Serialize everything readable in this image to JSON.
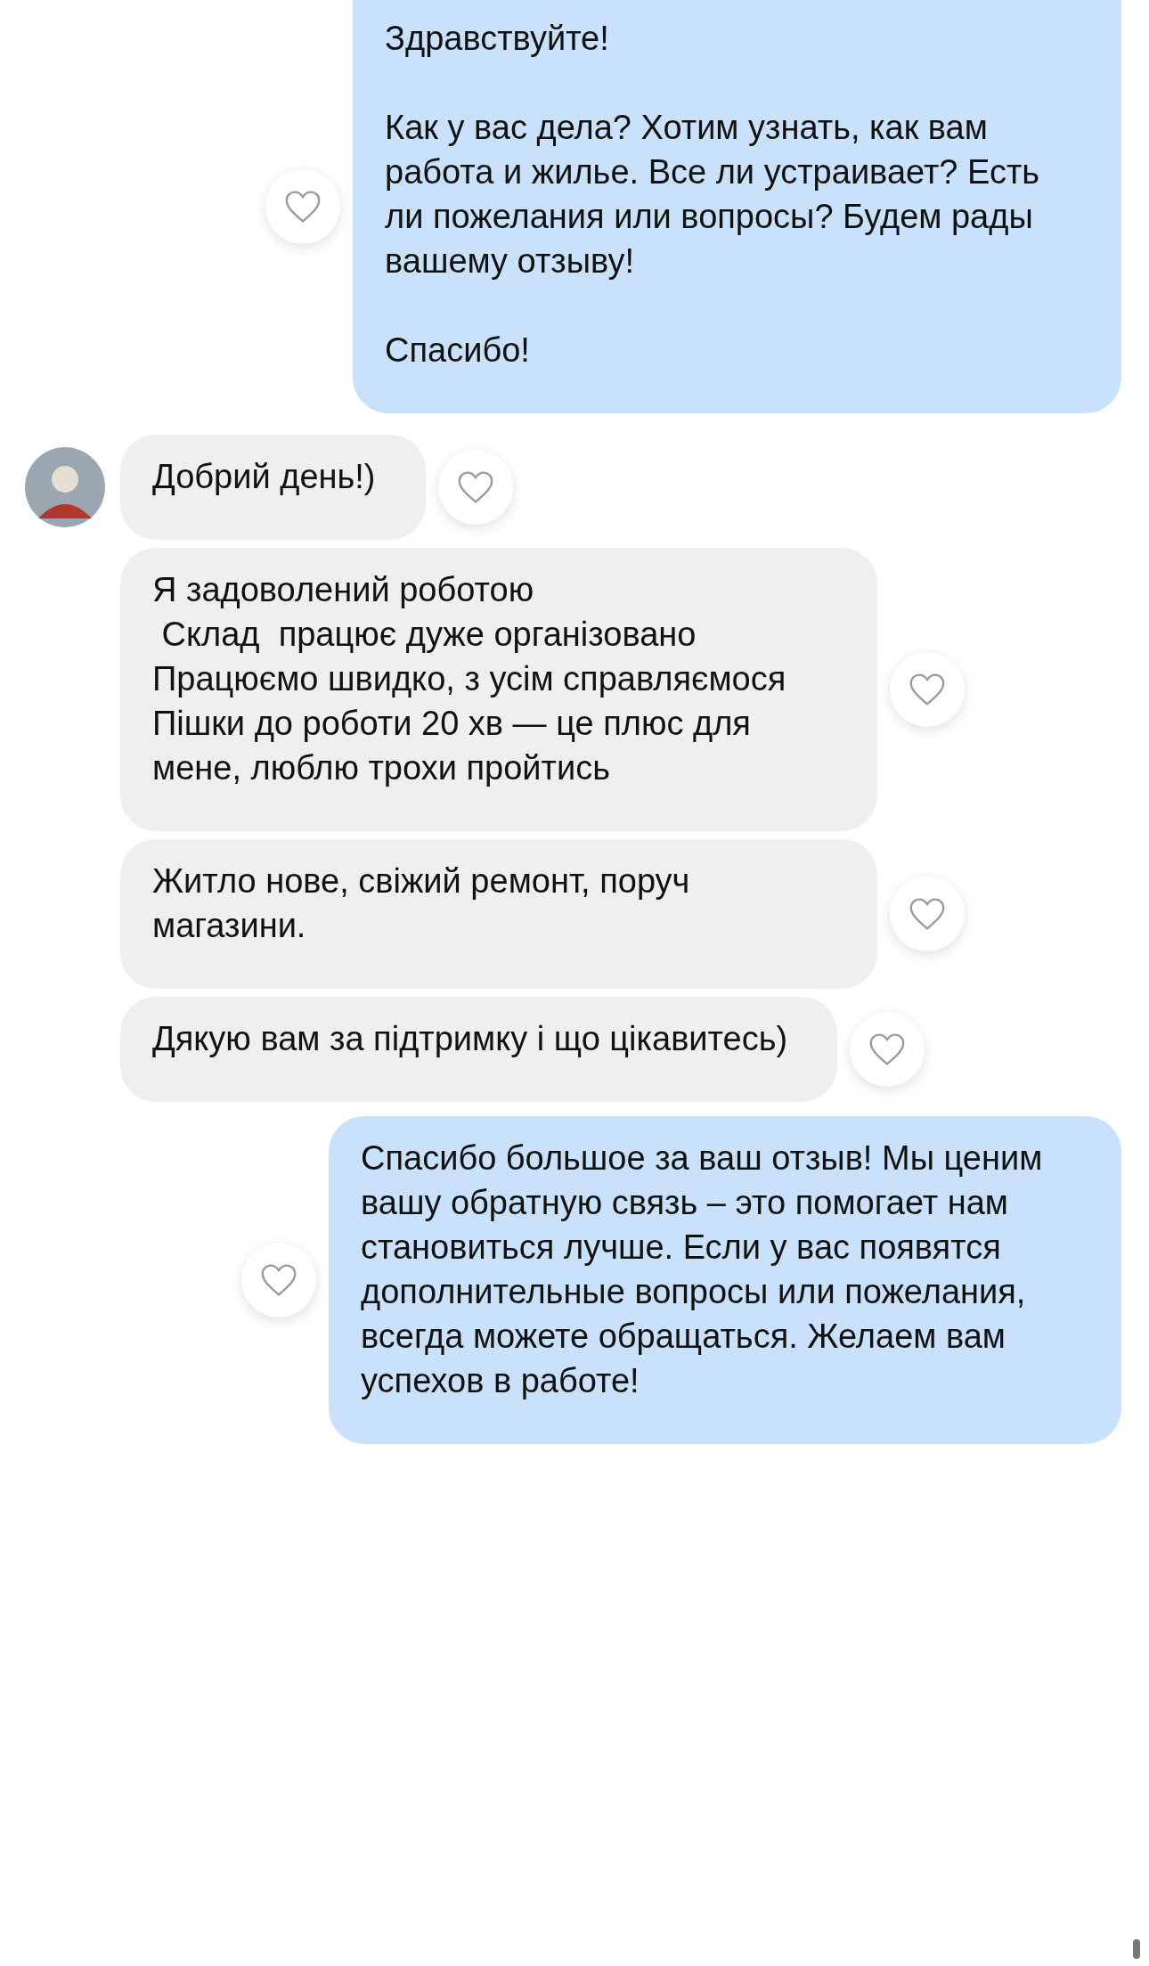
{
  "messages": [
    {
      "kind": "outgoing",
      "liked": false,
      "text": "Здравствуйте!\n\nКак у вас дела? Хотим узнать, как вам работа и жилье. Все ли устраивает? Есть ли пожелания или вопросы? Будем рады вашему отзыву!\n\nСпасибо!"
    },
    {
      "kind": "incoming",
      "avatar": true,
      "liked": false,
      "text": "Добрий день!)"
    },
    {
      "kind": "incoming",
      "avatar": false,
      "liked": false,
      "text": "Я задоволений роботою\n Склад  працює дуже організовано\nПрацюємо швидко, з усім справляємося\nПішки до роботи 20 хв — це плюс для мене, люблю трохи пройтись"
    },
    {
      "kind": "incoming",
      "avatar": false,
      "liked": false,
      "text": "Житло нове, свіжий ремонт, поруч магазини."
    },
    {
      "kind": "incoming",
      "avatar": false,
      "liked": false,
      "text": "Дякую вам за підтримку і що цікавитесь)"
    },
    {
      "kind": "outgoing",
      "liked": false,
      "text": "Спасибо большое за ваш отзыв! Мы ценим вашу обратную связь – это помогает нам становиться лучше. Если у вас появятся дополнительные вопросы или пожелания, всегда можете обращаться. Желаем вам успехов в работе!"
    }
  ]
}
